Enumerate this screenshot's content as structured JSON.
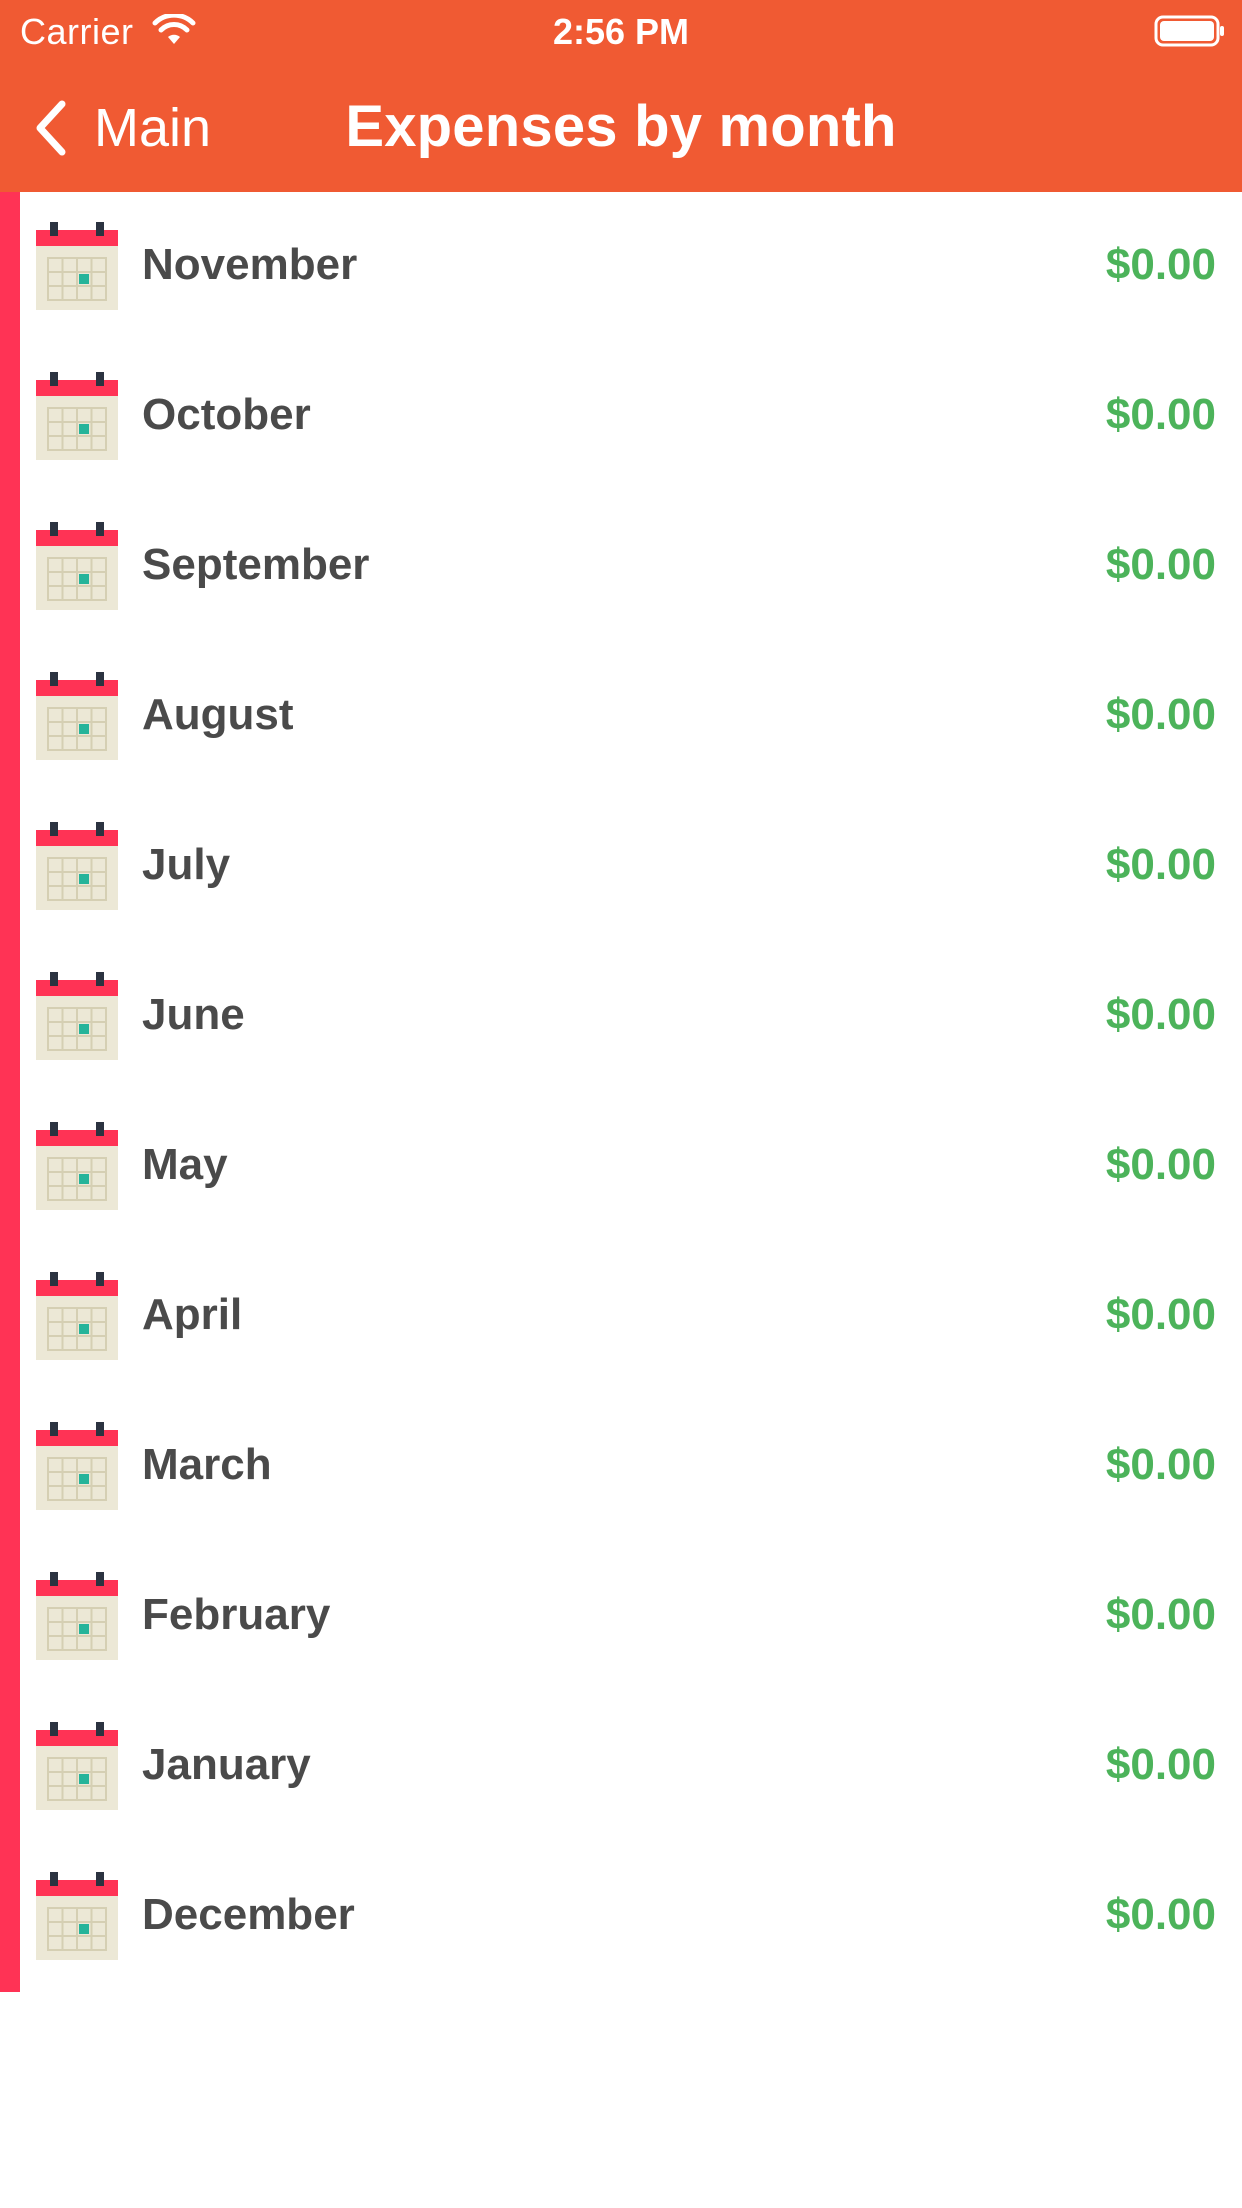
{
  "status_bar": {
    "carrier": "Carrier",
    "time": "2:56 PM"
  },
  "nav": {
    "back_label": "Main",
    "title": "Expenses by month"
  },
  "colors": {
    "nav_background": "#F05A33",
    "accent_stripe": "#FF3355",
    "month_text": "#4A4A4A",
    "amount_text": "#4CB35A"
  },
  "icons": {
    "back": "chevron-left-icon",
    "row": "calendar-icon"
  },
  "months": [
    {
      "name": "November",
      "amount": "$0.00"
    },
    {
      "name": "October",
      "amount": "$0.00"
    },
    {
      "name": "September",
      "amount": "$0.00"
    },
    {
      "name": "August",
      "amount": "$0.00"
    },
    {
      "name": "July",
      "amount": "$0.00"
    },
    {
      "name": "June",
      "amount": "$0.00"
    },
    {
      "name": "May",
      "amount": "$0.00"
    },
    {
      "name": "April",
      "amount": "$0.00"
    },
    {
      "name": "March",
      "amount": "$0.00"
    },
    {
      "name": "February",
      "amount": "$0.00"
    },
    {
      "name": "January",
      "amount": "$0.00"
    },
    {
      "name": "December",
      "amount": "$0.00"
    }
  ]
}
